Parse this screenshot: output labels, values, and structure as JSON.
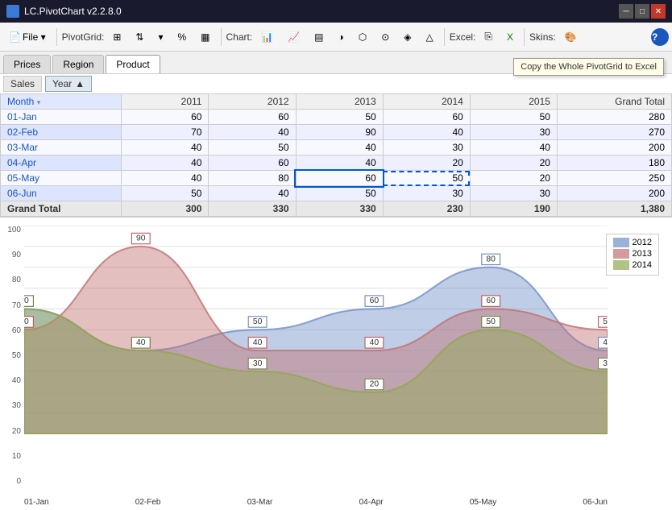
{
  "titlebar": {
    "title": "LC.PivotChart v2.2.8.0",
    "controls": [
      "–",
      "□",
      "×"
    ]
  },
  "toolbar": {
    "file_label": "File ▾",
    "pivot_grid_label": "PivotGrid:",
    "chart_label": "Chart:",
    "excel_label": "Excel:",
    "skins_label": "Skins:",
    "help_icon": "?"
  },
  "tabs": [
    {
      "label": "Prices",
      "active": false
    },
    {
      "label": "Region",
      "active": false
    },
    {
      "label": "Product",
      "active": true
    }
  ],
  "tooltip": "Copy the Whole PivotGrid to Excel",
  "pivot": {
    "sales_label": "Sales",
    "year_filter": "Year",
    "year_sort": "▲",
    "columns": [
      "",
      "2011",
      "2012",
      "2013",
      "2014",
      "2015",
      "Grand Total"
    ],
    "month_header": "Month",
    "rows": [
      {
        "month": "01-Jan",
        "values": [
          60,
          60,
          50,
          60,
          50,
          280
        ]
      },
      {
        "month": "02-Feb",
        "values": [
          70,
          40,
          90,
          40,
          30,
          270
        ]
      },
      {
        "month": "03-Mar",
        "values": [
          40,
          50,
          40,
          30,
          40,
          200
        ]
      },
      {
        "month": "04-Apr",
        "values": [
          40,
          60,
          40,
          20,
          20,
          180
        ]
      },
      {
        "month": "05-May",
        "values": [
          40,
          80,
          60,
          50,
          20,
          250
        ]
      },
      {
        "month": "06-Jun",
        "values": [
          50,
          40,
          50,
          30,
          30,
          200
        ]
      }
    ],
    "grand_total_label": "Grand Total",
    "grand_total_values": [
      300,
      330,
      330,
      230,
      190,
      "1,380"
    ],
    "selected_cell": {
      "row": 5,
      "col": 3
    }
  },
  "chart": {
    "y_labels": [
      "0",
      "10",
      "20",
      "30",
      "40",
      "50",
      "60",
      "70",
      "80",
      "90",
      "100"
    ],
    "x_labels": [
      "01-Jan",
      "02-Feb",
      "03-Mar",
      "04-Apr",
      "05-May",
      "06-Jun"
    ],
    "legend": [
      {
        "label": "2012",
        "color": "#7090c8"
      },
      {
        "label": "2013",
        "color": "#c07070"
      },
      {
        "label": "2014",
        "color": "#90a850"
      }
    ],
    "series": {
      "2012": {
        "color": "#7090c8",
        "values": [
          60,
          40,
          50,
          60,
          80,
          40
        ]
      },
      "2013": {
        "color": "#c07070",
        "values": [
          50,
          90,
          40,
          40,
          60,
          50
        ]
      },
      "2014": {
        "color": "#90a850",
        "values": [
          60,
          40,
          30,
          20,
          50,
          30
        ]
      }
    }
  }
}
